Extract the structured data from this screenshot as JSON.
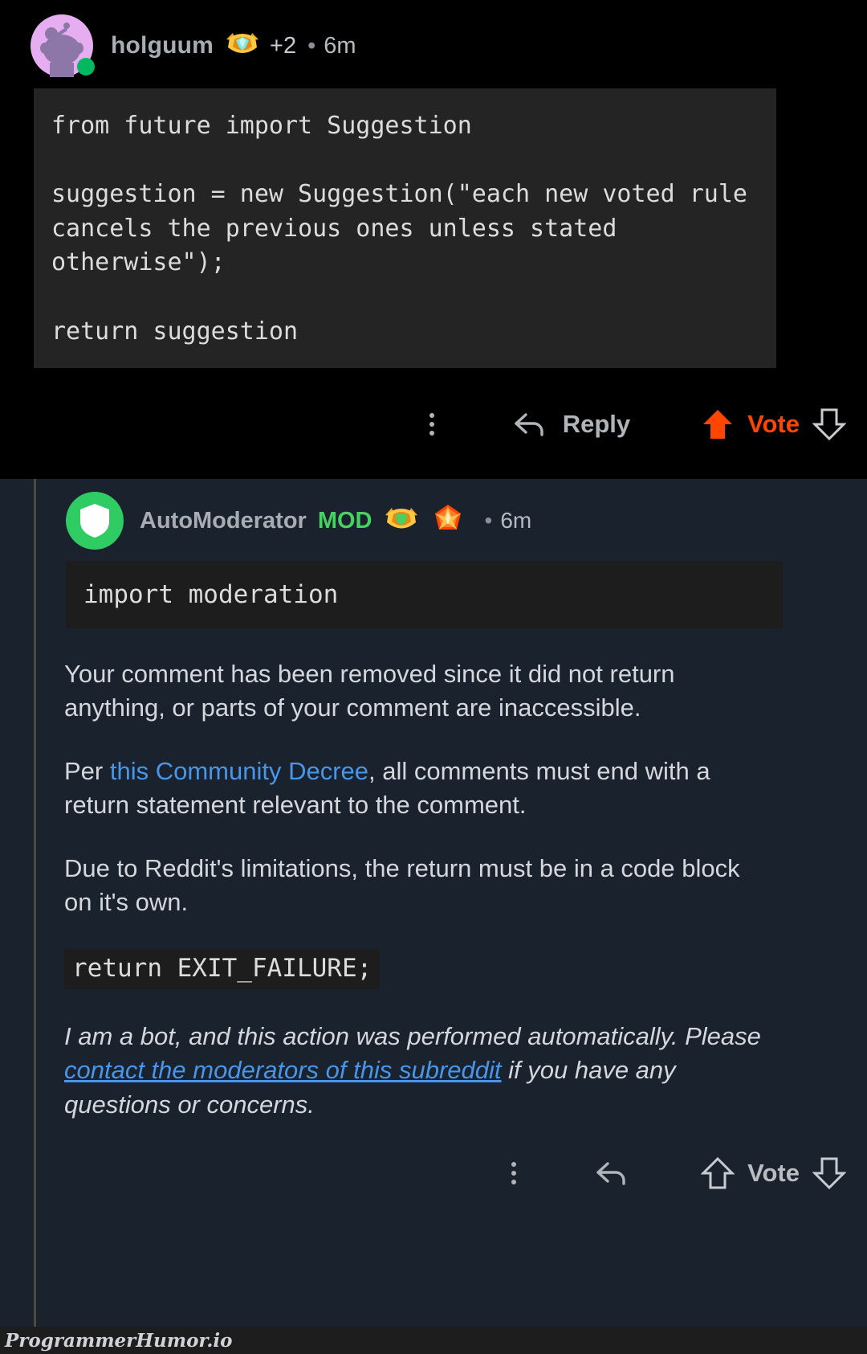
{
  "comments": [
    {
      "author": "holguum",
      "author_badge_icon": "gem-award-icon",
      "karma": "+2",
      "separator": "•",
      "time": "6m",
      "code": "from future import Suggestion\n\nsuggestion = new Suggestion(\"each new voted rule cancels the previous ones unless stated otherwise\");\n\nreturn suggestion",
      "actions": {
        "more_icon": "kebab-menu-icon",
        "reply_icon": "reply-arrow-icon",
        "reply_label": "Reply",
        "upvote_icon": "upvote-arrow-icon",
        "vote_label": "Vote",
        "downvote_icon": "downvote-arrow-icon"
      }
    },
    {
      "author": "AutoModerator",
      "mod_tag": "MOD",
      "avatar_icon": "shield-icon",
      "award_icons": [
        "gold-heart-award-icon",
        "orange-gem-award-icon"
      ],
      "separator": "•",
      "time": "6m",
      "code": "import moderation",
      "paragraphs": [
        "Your comment has been removed since it did not return anything, or parts of your comment are inaccessible."
      ],
      "decree_prefix": "Per ",
      "decree_link": "this Community Decree",
      "decree_suffix": ", all comments must end with a return statement relevant to the comment.",
      "limitation_paragraph": "Due to Reddit's limitations, the return must be in a code block on it's own.",
      "inline_code": "return EXIT_FAILURE;",
      "disclaimer_prefix": "I am a bot, and this action was performed automatically. Please ",
      "disclaimer_link": "contact the moderators of this subreddit",
      "disclaimer_suffix": " if you have any questions or concerns.",
      "actions": {
        "more_icon": "kebab-menu-icon",
        "reply_icon": "reply-arrow-icon",
        "upvote_icon": "upvote-arrow-icon",
        "vote_label": "Vote",
        "downvote_icon": "downvote-arrow-icon"
      }
    }
  ],
  "watermark": "ProgrammerHumor.io",
  "colors": {
    "top_background": "#000000",
    "bottom_background": "#1a222e",
    "code_background_top": "#242424",
    "code_background_bottom": "#1d1d1d",
    "vote_orange": "#ff4500",
    "mod_green": "#46d160",
    "link_blue": "#4996e8",
    "thread_line": "#4a4a3f",
    "online_dot": "#00b860"
  }
}
